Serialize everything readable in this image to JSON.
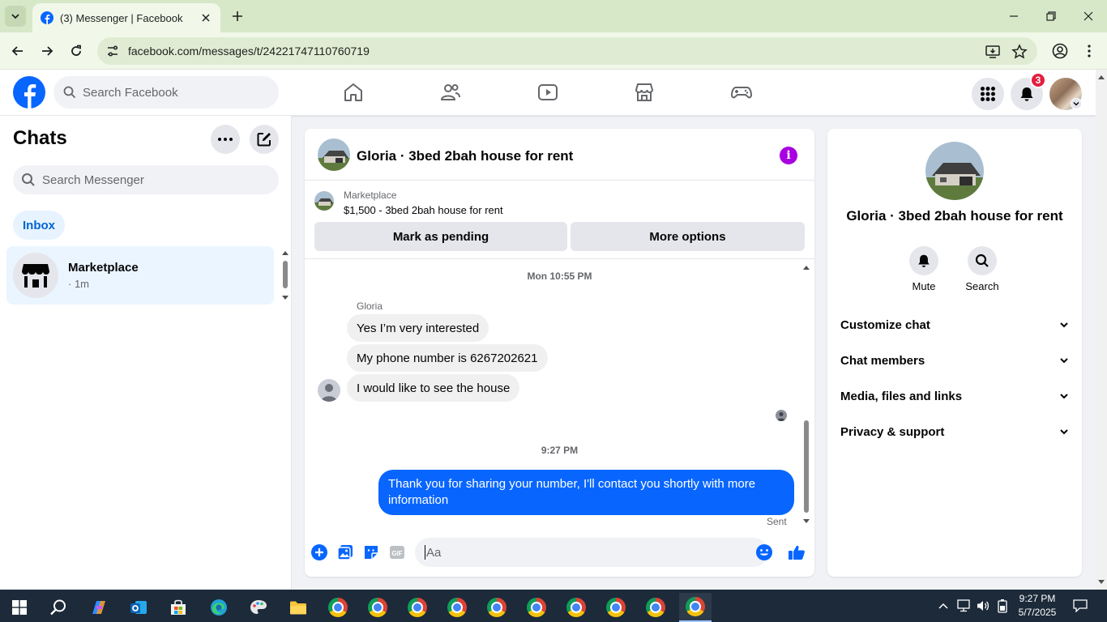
{
  "browser": {
    "tab_title": "(3) Messenger | Facebook",
    "url": "facebook.com/messages/t/24221747110760719"
  },
  "header": {
    "search_placeholder": "Search Facebook",
    "notification_count": "3"
  },
  "chats": {
    "title": "Chats",
    "search_placeholder": "Search Messenger",
    "filter_chip": "Inbox",
    "items": [
      {
        "name": "Marketplace",
        "subtitle": "· 1m"
      }
    ]
  },
  "conversation": {
    "title": "Gloria · 3bed 2bah house for rent",
    "marketplace_label": "Marketplace",
    "listing": "$1,500 - 3bed 2bah house for rent",
    "mark_pending_label": "Mark as pending",
    "more_options_label": "More options",
    "timestamps": [
      "Mon 10:55 PM",
      "9:27 PM"
    ],
    "sender_name": "Gloria",
    "incoming": [
      "Yes I’m very interested",
      "My phone number is 6267202621",
      "I would like to see the house"
    ],
    "outgoing": "Thank you for sharing your number, I'll contact you shortly with more information",
    "status": "Sent",
    "composer_placeholder": "Aa"
  },
  "details": {
    "name": "Gloria · 3bed 2bah house for rent",
    "actions": [
      "Mute",
      "Search"
    ],
    "sections": [
      "Customize chat",
      "Chat members",
      "Media, files and links",
      "Privacy & support"
    ]
  },
  "taskbar": {
    "time": "9:27 PM",
    "date": "5/7/2025"
  },
  "colors": {
    "brand_blue": "#0866ff",
    "info_purple": "#a800e0",
    "badge_red": "#e41e3f"
  }
}
